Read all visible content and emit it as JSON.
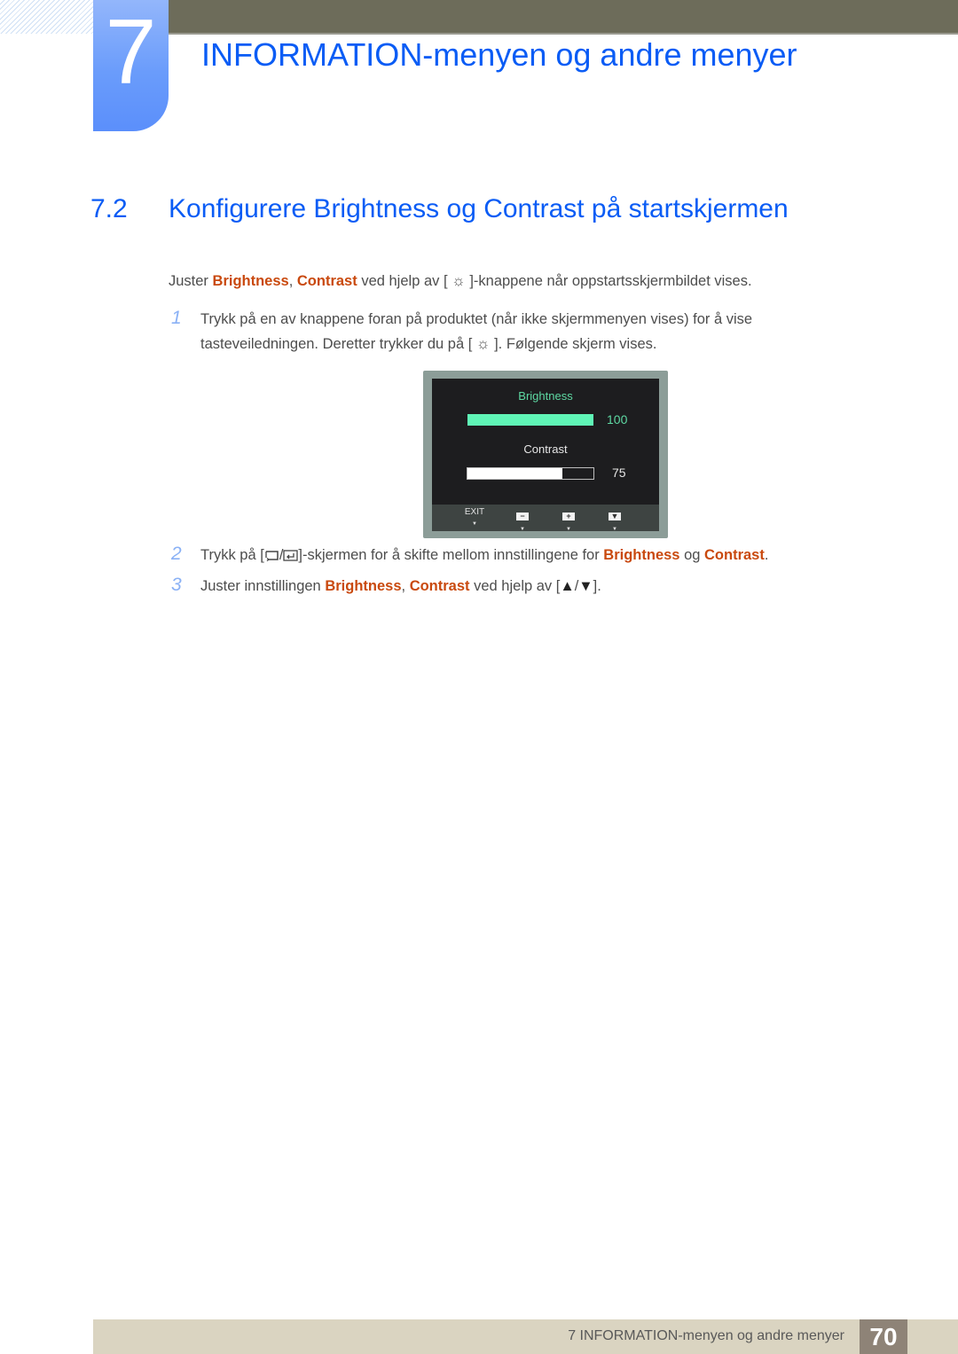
{
  "chapter": {
    "number": "7",
    "title": "INFORMATION-menyen og andre menyer"
  },
  "section": {
    "number": "7.2",
    "title": "Konfigurere Brightness og Contrast på startskjermen"
  },
  "intro": {
    "text_1": "Juster ",
    "hl_1": "Brightness",
    "sep": ", ",
    "hl_2": "Contrast",
    "text_2": " ved hjelp av [ ",
    "icon": "sun-icon",
    "text_3": " ]-knappene når oppstartsskjermbildet vises."
  },
  "steps": [
    {
      "number": "1",
      "line_1": "Trykk på en av knappene foran på produktet (når ikke skjermmenyen vises) for å vise",
      "line_2_a": "tasteveiledningen. Deretter trykker du på [ ",
      "line_2_icon": "sun-icon",
      "line_2_b": " ]. Følgende skjerm vises."
    },
    {
      "number": "2",
      "text_1": "Trykk på [",
      "icons": [
        "source-icon",
        "enter-icon"
      ],
      "slash": "/",
      "text_2": "]-skjermen for å skifte mellom innstillingene for ",
      "hl_1": "Brightness",
      "text_3": " og ",
      "hl_2": "Contrast",
      "text_4": "."
    },
    {
      "number": "3",
      "text_1": "Juster innstillingen ",
      "hl_1": "Brightness",
      "sep": ", ",
      "hl_2": "Contrast",
      "text_2": " ved hjelp av [",
      "up": "▲",
      "slash": "/",
      "down": "▼",
      "text_3": "]."
    }
  ],
  "osd": {
    "brightness_label": "Brightness",
    "brightness_value": "100",
    "brightness_fraction": 1.0,
    "contrast_label": "Contrast",
    "contrast_value": "75",
    "contrast_fraction": 0.75,
    "accent_color": "#5ff5b6",
    "buttons": [
      {
        "label": "EXIT",
        "key": ""
      },
      {
        "label": "",
        "key": "−"
      },
      {
        "label": "",
        "key": "+"
      },
      {
        "label": "",
        "key": "▼"
      }
    ],
    "pointer": "▼"
  },
  "footer": {
    "text": "7 INFORMATION-menyen og andre menyer",
    "page": "70"
  }
}
